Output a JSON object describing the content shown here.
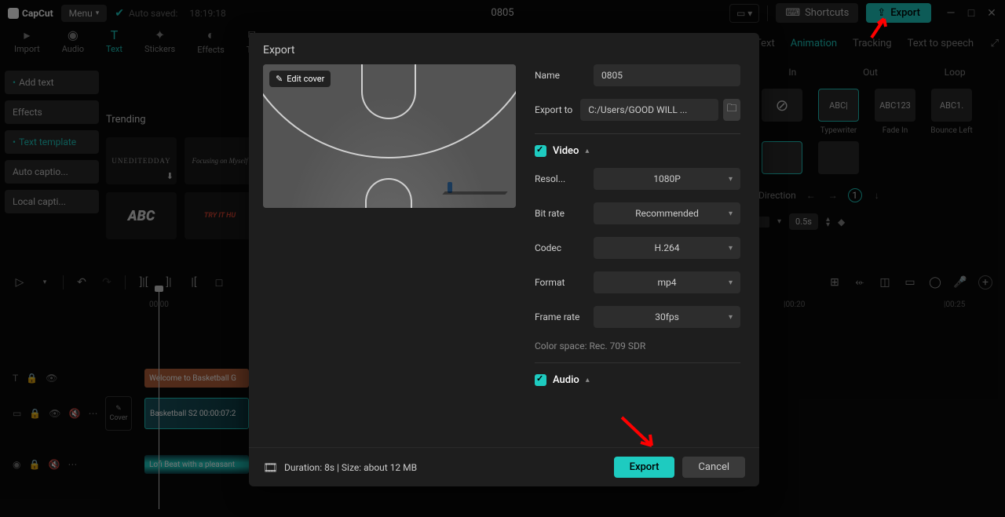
{
  "app": {
    "name": "CapCut",
    "menu_label": "Menu",
    "auto_saved_prefix": "Auto saved:",
    "auto_saved_time": "18:19:18",
    "project_title": "0805",
    "shortcuts_label": "Shortcuts",
    "export_label": "Export"
  },
  "top_nav": {
    "import": "Import",
    "audio": "Audio",
    "text": "Text",
    "stickers": "Stickers",
    "effects": "Effects",
    "transitions": "Tra"
  },
  "sidebar": {
    "add_text": "Add text",
    "effects": "Effects",
    "text_template": "Text template",
    "auto_captions": "Auto captio...",
    "local_captions": "Local capti..."
  },
  "content": {
    "trending": "Trending",
    "thumbs": [
      "UNEDITEDDAY",
      "Focusing on Myself",
      "ABC",
      "TRY IT HU"
    ]
  },
  "right": {
    "tabs": {
      "text": "Text",
      "animation": "Animation",
      "tracking": "Tracking",
      "tts": "Text to speech"
    },
    "subtabs": {
      "in": "In",
      "out": "Out",
      "loop": "Loop"
    },
    "presets": {
      "none": "⊘",
      "typewriter": "Typewriter",
      "typewriter_sample": "ABC|",
      "fadein": "Fade In",
      "fadein_sample": "ABC123",
      "bounceleft": "Bounce Left",
      "bounceleft_sample": "ABC1."
    },
    "direction_label": "Direction",
    "direction_value": "1",
    "duration_value": "0.5s"
  },
  "timeline": {
    "marks": [
      "00:00",
      "|00:20",
      "|00:25"
    ],
    "clip_text": "Welcome to Basketball G",
    "clip_video": "Basketball S2   00:00:07:2",
    "clip_audio": "Lofi Beat with a pleasant",
    "cover_label": "Cover"
  },
  "export_modal": {
    "title": "Export",
    "edit_cover": "Edit cover",
    "name_label": "Name",
    "name_value": "0805",
    "export_to_label": "Export to",
    "export_to_value": "C:/Users/GOOD WILL ...",
    "video_section": "Video",
    "resolution_label": "Resol...",
    "resolution_value": "1080P",
    "bitrate_label": "Bit rate",
    "bitrate_value": "Recommended",
    "codec_label": "Codec",
    "codec_value": "H.264",
    "format_label": "Format",
    "format_value": "mp4",
    "framerate_label": "Frame rate",
    "framerate_value": "30fps",
    "color_space": "Color space: Rec. 709 SDR",
    "audio_section": "Audio",
    "duration_info": "Duration: 8s | Size: about 12 MB",
    "export_btn": "Export",
    "cancel_btn": "Cancel"
  }
}
